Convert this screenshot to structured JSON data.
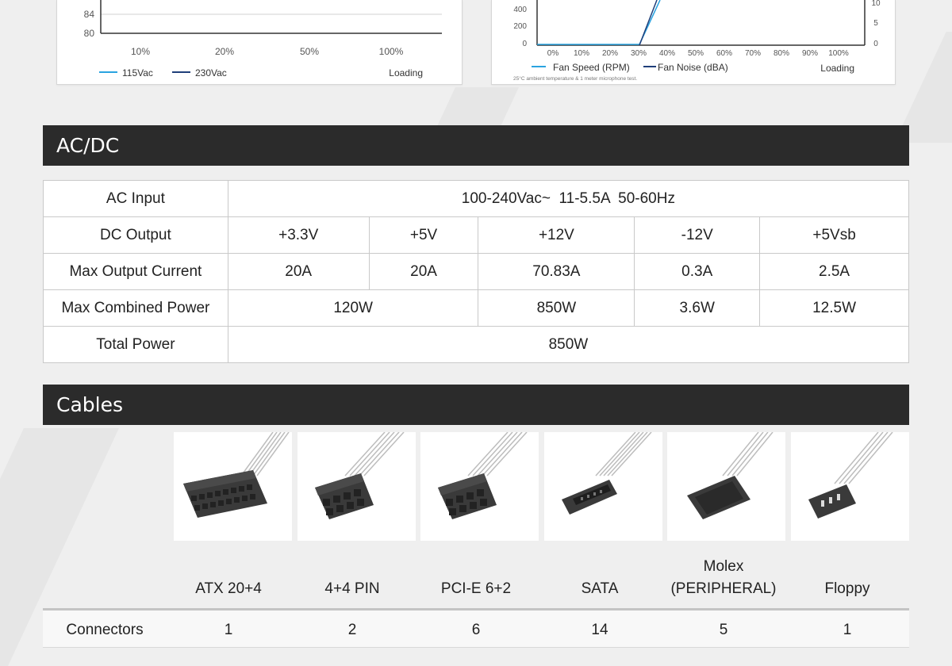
{
  "efficiency_chart": {
    "y_ticks": [
      "84",
      "80"
    ],
    "x_ticks": [
      "10%",
      "20%",
      "50%",
      "100%"
    ],
    "legend": [
      {
        "label": "115Vac",
        "color": "#2aa3e0"
      },
      {
        "label": "230Vac",
        "color": "#1f3f7a"
      }
    ],
    "x_title": "Loading"
  },
  "fan_chart": {
    "y_ticks_left": [
      "400",
      "200",
      "0"
    ],
    "y_ticks_right": [
      "10",
      "5",
      "0"
    ],
    "x_ticks": [
      "0%",
      "10%",
      "20%",
      "30%",
      "40%",
      "50%",
      "60%",
      "70%",
      "80%",
      "90%",
      "100%"
    ],
    "legend": [
      {
        "label": "Fan Speed (RPM)",
        "color": "#2aa3e0"
      },
      {
        "label": "Fan Noise (dBA)",
        "color": "#1f3f7a"
      }
    ],
    "x_title": "Loading",
    "footnote": "25°C ambient temperature & 1 meter microphone test."
  },
  "acdc": {
    "title": "AC/DC",
    "ac_input_label": "AC Input",
    "ac_input_value": "100-240Vac~  11-5.5A  50-60Hz",
    "dc_output_label": "DC Output",
    "dc_output": [
      "+3.3V",
      "+5V",
      "+12V",
      "-12V",
      "+5Vsb"
    ],
    "max_current_label": "Max Output Current",
    "max_current": [
      "20A",
      "20A",
      "70.83A",
      "0.3A",
      "2.5A"
    ],
    "combined_label": "Max Combined Power",
    "combined": [
      "120W",
      "850W",
      "3.6W",
      "12.5W"
    ],
    "total_label": "Total Power",
    "total": "850W"
  },
  "cables": {
    "title": "Cables",
    "items": [
      {
        "name": "ATX 20+4",
        "count": "1"
      },
      {
        "name": "4+4 PIN",
        "count": "2"
      },
      {
        "name": "PCI-E 6+2",
        "count": "6"
      },
      {
        "name": "SATA",
        "count": "14"
      },
      {
        "name": "Molex\n(PERIPHERAL)",
        "name_line1": "Molex",
        "name_line2": "(PERIPHERAL)",
        "count": "5"
      },
      {
        "name": "Floppy",
        "count": "1"
      }
    ],
    "connectors_label": "Connectors"
  }
}
